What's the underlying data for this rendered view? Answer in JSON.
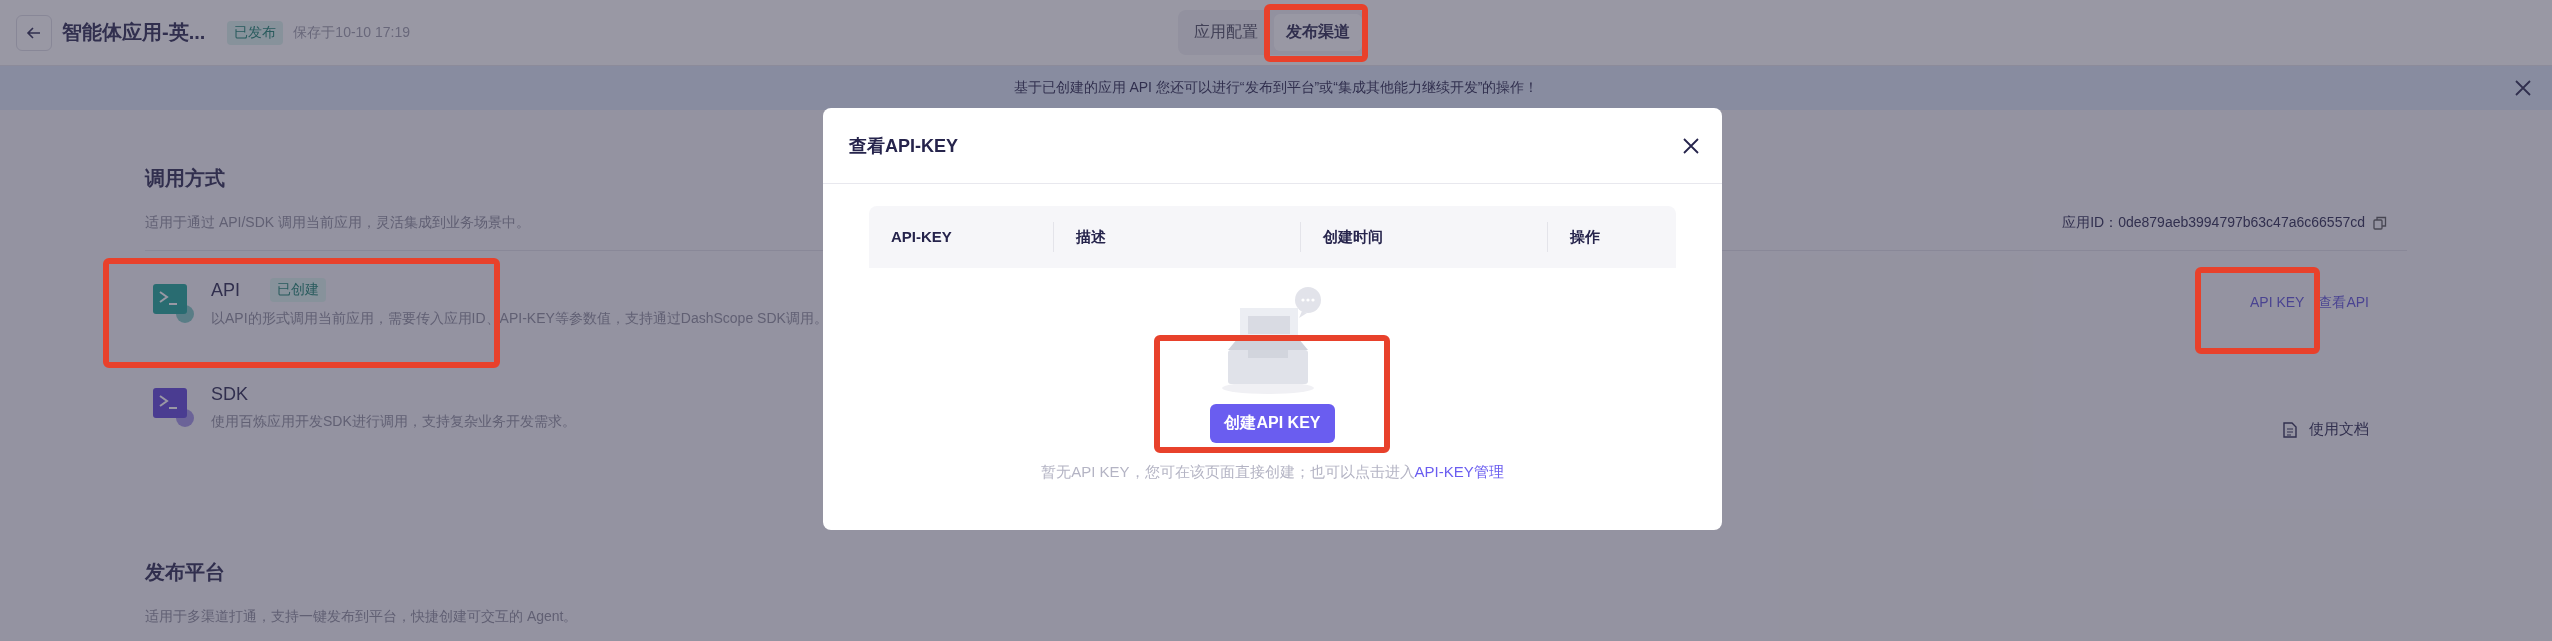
{
  "header": {
    "title": "智能体应用-英...",
    "status_badge": "已发布",
    "saved_text": "保存于10-10 17:19"
  },
  "tabs": [
    {
      "label": "应用配置",
      "selected": false
    },
    {
      "label": "发布渠道",
      "selected": true
    }
  ],
  "banner": {
    "text": "基于已创建的应用 API 您还可以进行“发布到平台”或“集成其他能力继续开发”的操作！"
  },
  "sections": [
    {
      "title": "调用方式",
      "description": "适用于通过 API/SDK 调用当前应用，灵活集成到业务场景中。",
      "app_id_label": "应用ID：",
      "app_id": "0de879aeb3994797b63c47a6c66557cd",
      "items": [
        {
          "kind": "api",
          "title": "API",
          "badge": "已创建",
          "description": "以API的形式调用当前应用，需要传入应用ID、API-KEY等参数值，支持通过DashScope SDK调用。",
          "links": [
            "API KEY",
            "查看API"
          ]
        },
        {
          "kind": "sdk",
          "title": "SDK",
          "description": "使用百炼应用开发SDK进行调用，支持复杂业务开发需求。",
          "doc_link": "使用文档"
        }
      ]
    },
    {
      "title": "发布平台",
      "description": "适用于多渠道打通，支持一键发布到平台，快捷创建可交互的 Agent。"
    }
  ],
  "modal": {
    "title": "查看API-KEY",
    "columns": [
      "API-KEY",
      "描述",
      "创建时间",
      "操作"
    ],
    "create_button": "创建API KEY",
    "empty_text": "暂无API KEY，您可在该页面直接创建；也可以点击进入",
    "empty_link": "API-KEY管理"
  }
}
